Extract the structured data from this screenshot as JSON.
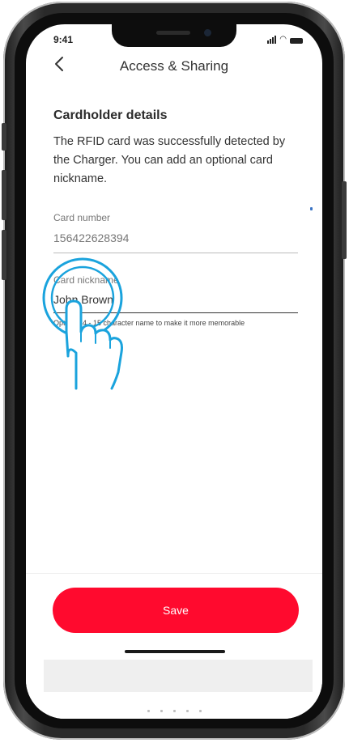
{
  "status_bar": {
    "time": "9:41"
  },
  "header": {
    "title": "Access & Sharing",
    "back_icon": "chevron-left-icon"
  },
  "section": {
    "title": "Cardholder details",
    "description": "The RFID card was successfully detected by the Charger. You can add an optional card nickname."
  },
  "card_number": {
    "label": "Card number",
    "value": "156422628394"
  },
  "card_nickname": {
    "label": "Card nickname",
    "value": "John Brown",
    "helper": "Optional 4 - 15 character name to make it more memorable"
  },
  "save_button": {
    "label": "Save"
  },
  "colors": {
    "accent": "#ff0a2e",
    "tap_indicator": "#1aa3dd"
  }
}
